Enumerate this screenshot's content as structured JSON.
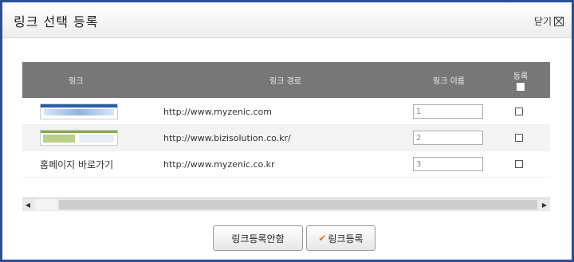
{
  "dialog": {
    "title": "링크 선택 등록",
    "close_label": "닫기"
  },
  "table": {
    "headers": {
      "link": "링크",
      "path": "링크 경로",
      "name": "링크 이름",
      "register": "등록"
    },
    "rows": [
      {
        "link_text": "",
        "path": "http://www.myzenic.com",
        "name": "1"
      },
      {
        "link_text": "",
        "path": "http://www.bizisolution.co.kr/",
        "name": "2"
      },
      {
        "link_text": "홈페이지 바로가기",
        "path": "http://www.myzenic.co.kr",
        "name": "3"
      }
    ]
  },
  "buttons": {
    "cancel": "링크등록안함",
    "register": "링크등록"
  },
  "colors": {
    "frame": "#2a4f94",
    "header_bg": "#777777",
    "accent_check": "#e07a16"
  }
}
